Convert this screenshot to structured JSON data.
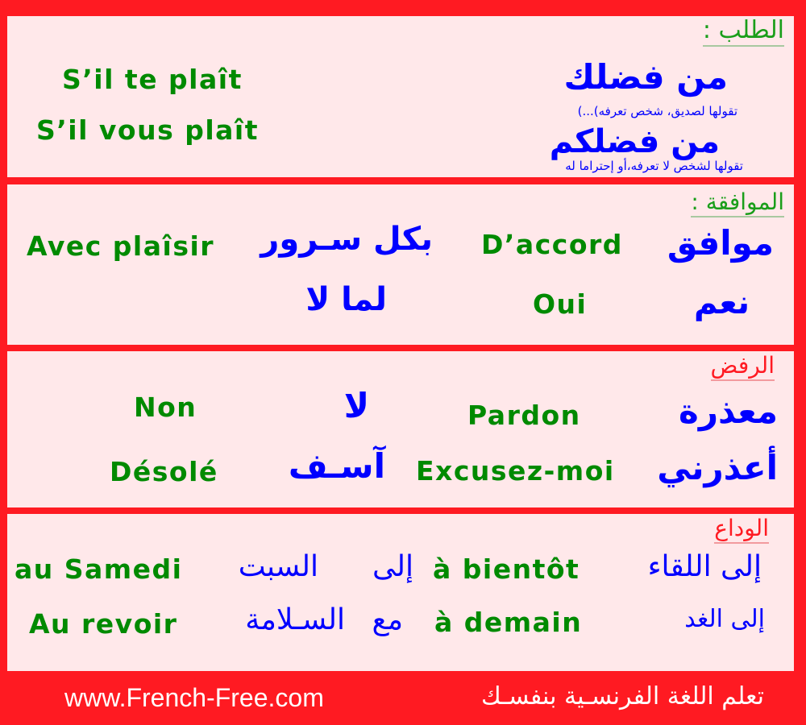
{
  "colors": {
    "frame": "#ff1a22",
    "panel_background": "#ffe8ea",
    "french_text": "#008a00",
    "arabic_text": "#0000ff",
    "title_green": "#1a9e1a",
    "title_red": "#ff1a22",
    "footer_text": "#ffffff"
  },
  "sections": [
    {
      "title": "الطلب :",
      "rows": [
        {
          "arabic": "من فضلك",
          "note": "تقولها لصديق، شخص تعرفه)...)",
          "french": "S’il te plaît"
        },
        {
          "arabic": "من فضلكم",
          "note": "تقولها لشخص لا تعرفه،أو إحتراما له",
          "french": "S’il vous plaît"
        }
      ]
    },
    {
      "title": "الموافقة :",
      "pairs": [
        {
          "arabic": "موافق",
          "french": "D’accord"
        },
        {
          "arabic": "بكل سـرور",
          "french": "Avec plaîsir"
        },
        {
          "arabic": "نعم",
          "french": "Oui"
        },
        {
          "arabic": "لما لا",
          "french": ""
        }
      ]
    },
    {
      "title": "الرفض",
      "pairs": [
        {
          "arabic": "معذرة",
          "french": "Pardon"
        },
        {
          "arabic": "لا",
          "french": "Non"
        },
        {
          "arabic": "أعذرني",
          "french": "Excusez-moi"
        },
        {
          "arabic": "آسـف",
          "french": "Désolé"
        }
      ]
    },
    {
      "title": "الوداع",
      "pairs": [
        {
          "arabic": "إلى اللقاء",
          "french": "à bientôt"
        },
        {
          "arabic": "إلى",
          "french": ""
        },
        {
          "arabic": "السبت",
          "french": "au Samedi"
        },
        {
          "arabic": "إلى الغد",
          "french": "à demain"
        },
        {
          "arabic": "مع",
          "french": ""
        },
        {
          "arabic": "السـلامة",
          "french": "Au revoir"
        }
      ]
    }
  ],
  "footer": {
    "url": "www.French-Free.com",
    "slogan": "تعلم اللغة الفرنسـية بنفسـك"
  }
}
